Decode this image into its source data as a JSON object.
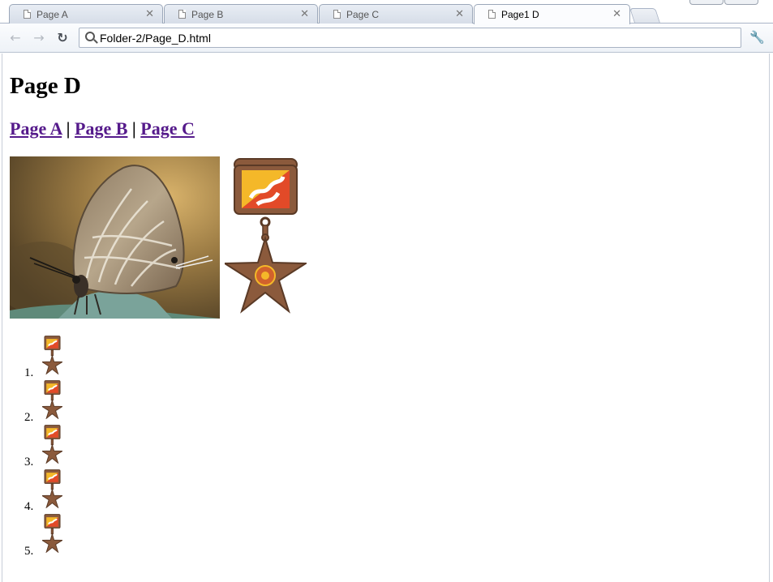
{
  "browser": {
    "tabs": [
      {
        "title": "Page A",
        "active": false
      },
      {
        "title": "Page B",
        "active": false
      },
      {
        "title": "Page C",
        "active": false
      },
      {
        "title": "Page1 D",
        "active": true
      }
    ],
    "address": "Folder-2/Page_D.html",
    "icons": {
      "back": "back-arrow-icon",
      "forward": "forward-arrow-icon",
      "reload": "reload-icon",
      "search": "search-icon",
      "menu": "wrench-icon",
      "tab": "page-icon",
      "close": "close-icon"
    }
  },
  "page": {
    "heading": "Page D",
    "links": [
      {
        "label": "Page A"
      },
      {
        "label": "Page B"
      },
      {
        "label": "Page C"
      }
    ],
    "separator": "|",
    "list_numbers": [
      "1.",
      "2.",
      "3.",
      "4.",
      "5."
    ],
    "colors": {
      "link_visited": "#551a8b",
      "medal_bronze": "#8b5a3c",
      "flag_yellow": "#f4b829",
      "flag_red": "#e24a28"
    }
  }
}
